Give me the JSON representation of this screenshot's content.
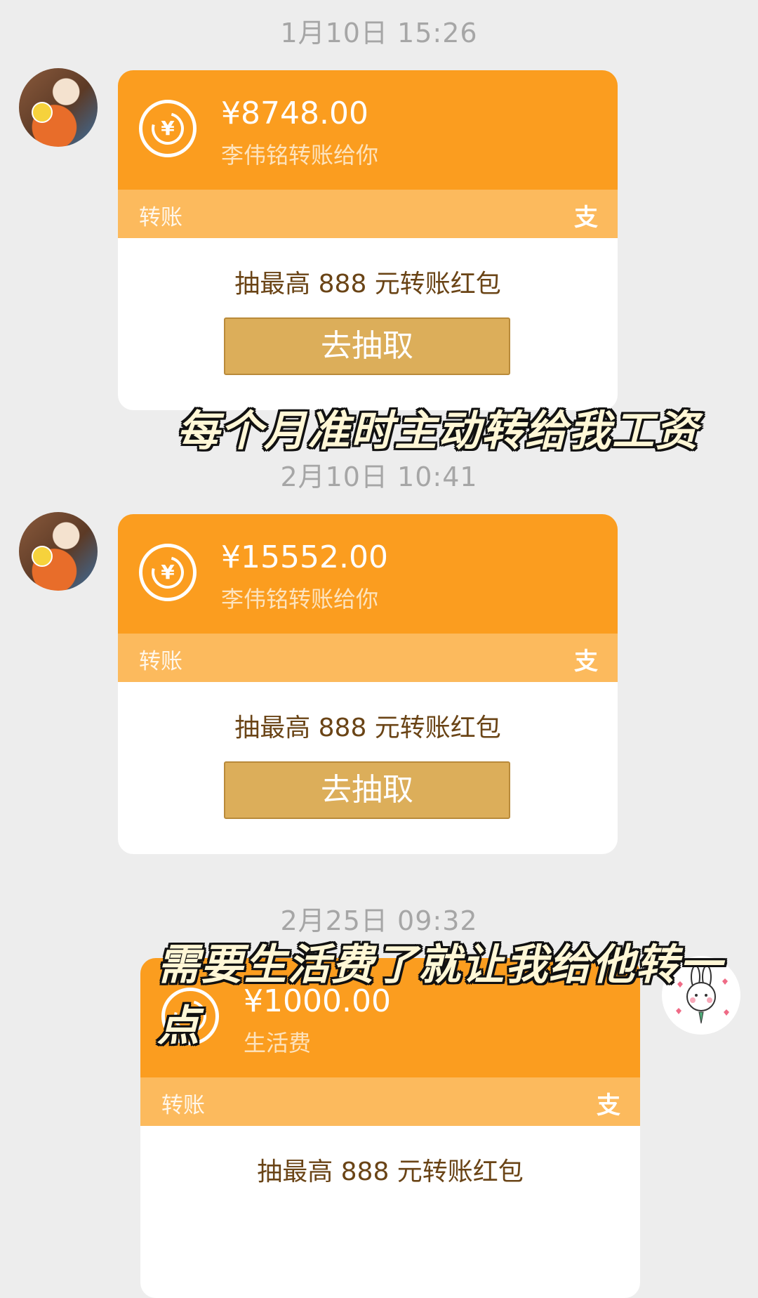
{
  "messages": [
    {
      "time": "1月10日 15:26",
      "amount": "¥8748.00",
      "note": "李伟铭转账给你",
      "label": "转账",
      "pay_icon": "支",
      "promo": "抽最高 888 元转账红包",
      "button": "去抽取"
    },
    {
      "time": "2月10日 10:41",
      "amount": "¥15552.00",
      "note": "李伟铭转账给你",
      "label": "转账",
      "pay_icon": "支",
      "promo": "抽最高 888 元转账红包",
      "button": "去抽取"
    },
    {
      "time": "2月25日 09:32",
      "amount": "¥1000.00",
      "note": "生活费",
      "label": "转账",
      "pay_icon": "支",
      "promo": "抽最高 888 元转账红包"
    }
  ],
  "captions": [
    "每个月准时主动转给我工资",
    "需要生活费了就让我给他转一点"
  ],
  "colors": {
    "background": "#ededed",
    "card_orange": "#fb9d1f",
    "card_strip": "#fcba5d",
    "button_gold": "#dcae5a"
  }
}
